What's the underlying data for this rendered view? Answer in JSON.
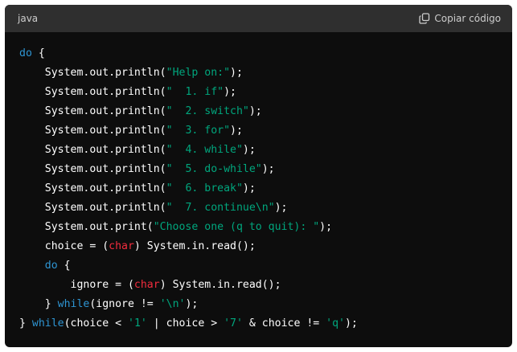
{
  "header": {
    "language": "java",
    "copy_label": "Copiar código",
    "copy_icon": "copy-icon"
  },
  "colors": {
    "keyword": "#2e95d3",
    "type": "#f22c3d",
    "string": "#00a67d",
    "plain": "#ffffff",
    "background": "#0d0d0d",
    "header_background": "#2f2f2f"
  },
  "code_lines": [
    [
      {
        "t": "kw",
        "v": "do"
      },
      {
        "t": "p",
        "v": " {"
      }
    ],
    [
      {
        "t": "p",
        "v": "    System.out.println("
      },
      {
        "t": "str",
        "v": "\"Help on:\""
      },
      {
        "t": "p",
        "v": ");"
      }
    ],
    [
      {
        "t": "p",
        "v": "    System.out.println("
      },
      {
        "t": "str",
        "v": "\"  1. if\""
      },
      {
        "t": "p",
        "v": ");"
      }
    ],
    [
      {
        "t": "p",
        "v": "    System.out.println("
      },
      {
        "t": "str",
        "v": "\"  2. switch\""
      },
      {
        "t": "p",
        "v": ");"
      }
    ],
    [
      {
        "t": "p",
        "v": "    System.out.println("
      },
      {
        "t": "str",
        "v": "\"  3. for\""
      },
      {
        "t": "p",
        "v": ");"
      }
    ],
    [
      {
        "t": "p",
        "v": "    System.out.println("
      },
      {
        "t": "str",
        "v": "\"  4. while\""
      },
      {
        "t": "p",
        "v": ");"
      }
    ],
    [
      {
        "t": "p",
        "v": "    System.out.println("
      },
      {
        "t": "str",
        "v": "\"  5. do-while\""
      },
      {
        "t": "p",
        "v": ");"
      }
    ],
    [
      {
        "t": "p",
        "v": "    System.out.println("
      },
      {
        "t": "str",
        "v": "\"  6. break\""
      },
      {
        "t": "p",
        "v": ");"
      }
    ],
    [
      {
        "t": "p",
        "v": "    System.out.println("
      },
      {
        "t": "str",
        "v": "\"  7. continue\\n\""
      },
      {
        "t": "p",
        "v": ");"
      }
    ],
    [
      {
        "t": "p",
        "v": "    System.out.print("
      },
      {
        "t": "str",
        "v": "\"Choose one (q to quit): \""
      },
      {
        "t": "p",
        "v": ");"
      }
    ],
    [
      {
        "t": "p",
        "v": "    choice = ("
      },
      {
        "t": "ty",
        "v": "char"
      },
      {
        "t": "p",
        "v": ") System.in.read();"
      }
    ],
    [
      {
        "t": "p",
        "v": "    "
      },
      {
        "t": "kw",
        "v": "do"
      },
      {
        "t": "p",
        "v": " {"
      }
    ],
    [
      {
        "t": "p",
        "v": "        ignore = ("
      },
      {
        "t": "ty",
        "v": "char"
      },
      {
        "t": "p",
        "v": ") System.in.read();"
      }
    ],
    [
      {
        "t": "p",
        "v": "    } "
      },
      {
        "t": "kw",
        "v": "while"
      },
      {
        "t": "p",
        "v": "(ignore != "
      },
      {
        "t": "str",
        "v": "'\\n'"
      },
      {
        "t": "p",
        "v": ");"
      }
    ],
    [
      {
        "t": "p",
        "v": "} "
      },
      {
        "t": "kw",
        "v": "while"
      },
      {
        "t": "p",
        "v": "(choice < "
      },
      {
        "t": "str",
        "v": "'1'"
      },
      {
        "t": "p",
        "v": " | choice > "
      },
      {
        "t": "str",
        "v": "'7'"
      },
      {
        "t": "p",
        "v": " & choice != "
      },
      {
        "t": "str",
        "v": "'q'"
      },
      {
        "t": "p",
        "v": ");"
      }
    ]
  ]
}
